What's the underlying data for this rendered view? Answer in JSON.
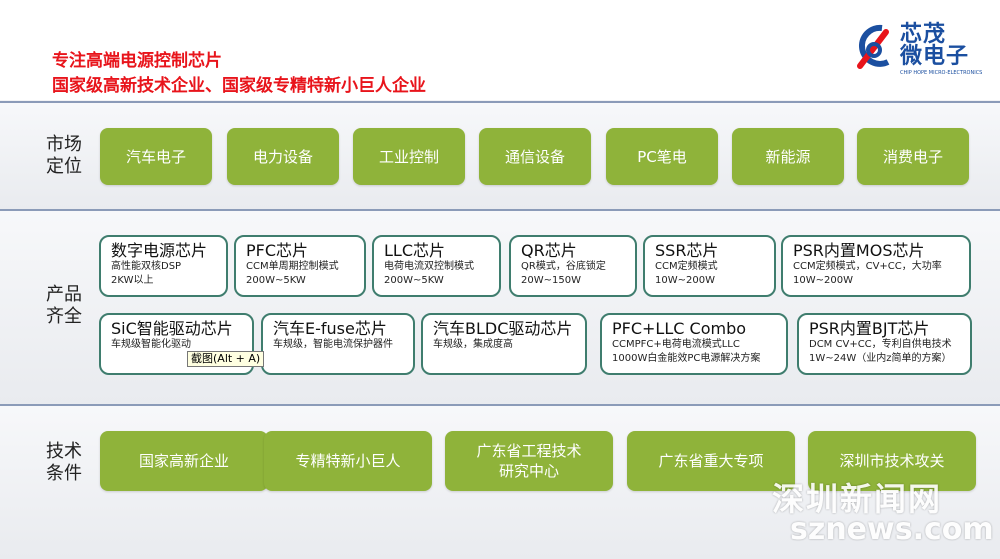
{
  "header": {
    "title_line1": "专注高端电源控制芯片",
    "title_line2": "国家级高新技术企业、国家级专精特新小巨人企业",
    "logo_text": "芯茂\n微电子",
    "logo_sub": "CHIP HOPE MICRO-ELECTRONICS"
  },
  "market": {
    "label": "市场\n定位",
    "items": [
      "汽车电子",
      "电力设备",
      "工业控制",
      "通信设备",
      "PC笔电",
      "新能源",
      "消费电子"
    ]
  },
  "products": {
    "label": "产品\n齐全",
    "row1": [
      {
        "title": "数字电源芯片",
        "lines": [
          "高性能双核DSP",
          "2KW以上"
        ]
      },
      {
        "title": "PFC芯片",
        "lines": [
          "CCM单周期控制模式",
          "200W~5KW"
        ]
      },
      {
        "title": "LLC芯片",
        "lines": [
          "电荷电流双控制模式",
          "200W~5KW"
        ]
      },
      {
        "title": "QR芯片",
        "lines": [
          "QR模式，谷底锁定",
          "20W~150W"
        ]
      },
      {
        "title": "SSR芯片",
        "lines": [
          "CCM定频模式",
          "10W~200W"
        ]
      },
      {
        "title": "PSR内置MOS芯片",
        "lines": [
          "CCM定频模式，CV+CC，大功率",
          "10W~200W"
        ]
      }
    ],
    "row2": [
      {
        "title": "SiC智能驱动芯片",
        "lines": [
          "车规级智能化驱动"
        ]
      },
      {
        "title": "汽车E-fuse芯片",
        "lines": [
          "车规级，智能电流保护器件"
        ]
      },
      {
        "title": "汽车BLDC驱动芯片",
        "lines": [
          "车规级，集成度高"
        ]
      },
      {
        "title": "PFC+LLC Combo",
        "lines": [
          "CCMPFC+电荷电流模式LLC",
          "1000W白金能效PC电源解决方案"
        ]
      },
      {
        "title": "PSR内置BJT芯片",
        "lines": [
          "DCM CV+CC，专利自供电技术",
          "1W~24W（业内z简单的方案）"
        ]
      }
    ]
  },
  "tooltip": "截图(Alt + A)",
  "tech": {
    "label": "技术\n条件",
    "items": [
      "国家高新企业",
      "专精特新小巨人",
      "广东省工程技术\n研究中心",
      "广东省重大专项",
      "深圳市技术攻关"
    ]
  },
  "watermark": {
    "cn": "深圳新闻网",
    "en": "sznews.com"
  },
  "colors": {
    "accent_red": "#e8141b",
    "pill_green": "#8fb33a",
    "card_border": "#3f7d6e",
    "logo_blue": "#1b4fa0"
  }
}
